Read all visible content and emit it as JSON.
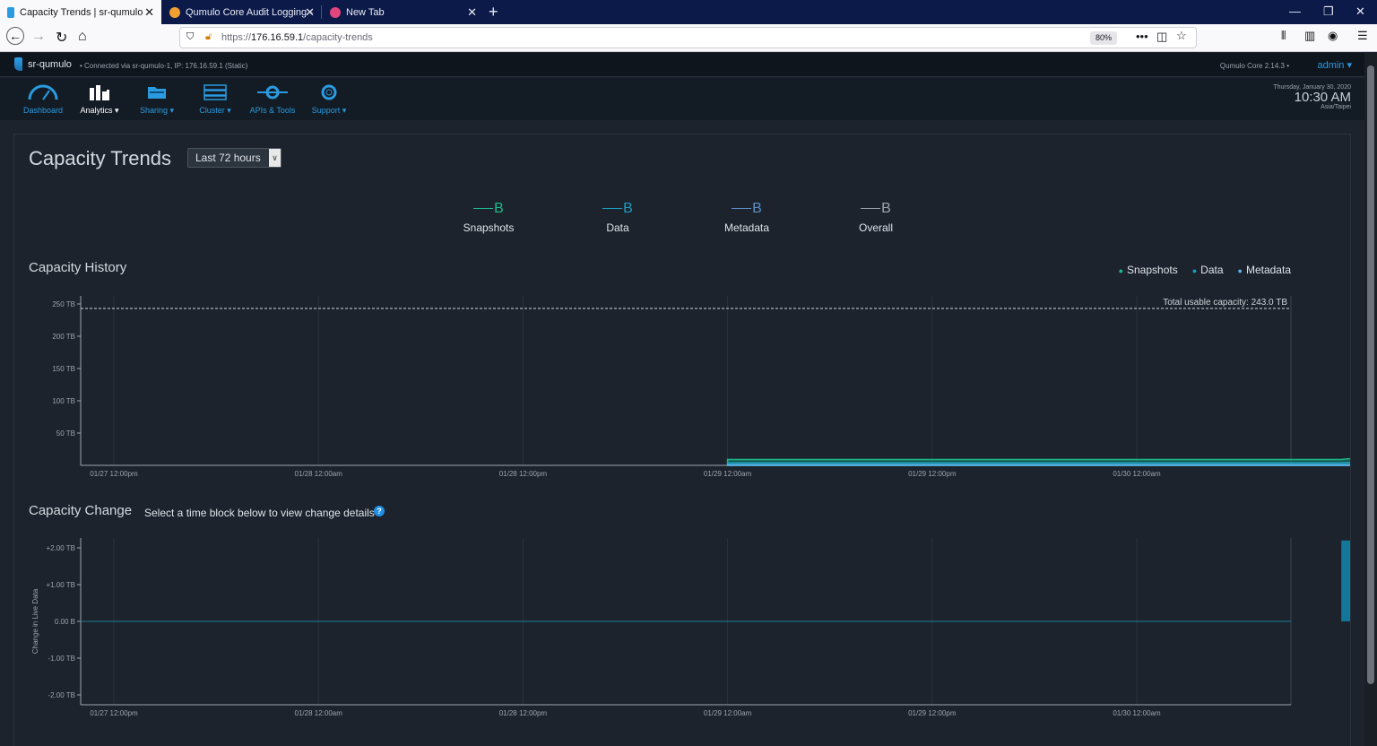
{
  "browser": {
    "tabs": [
      {
        "title": "Capacity Trends | sr-qumulo",
        "active": true
      },
      {
        "title": "Qumulo Core Audit Logging -",
        "active": false
      },
      {
        "title": "New Tab",
        "active": false
      }
    ],
    "url_prefix": "https://",
    "url_host": "176.16.59.1",
    "url_path": "/capacity-trends",
    "zoom": "80%"
  },
  "qumulo": {
    "cluster_name": "sr-qumulo",
    "connection": "Connected via sr-qumulo-1, IP: 176.16.59.1 (Static)",
    "version": "Qumulo Core 2.14.3",
    "user": "admin",
    "menu": [
      {
        "label": "Dashboard",
        "icon": "gauge-icon",
        "active": false
      },
      {
        "label": "Analytics ▾",
        "icon": "bar-chart-icon",
        "active": true
      },
      {
        "label": "Sharing ▾",
        "icon": "folder-share-icon",
        "active": false
      },
      {
        "label": "Cluster ▾",
        "icon": "server-icon",
        "active": false
      },
      {
        "label": "APIs & Tools",
        "icon": "api-icon",
        "active": false
      },
      {
        "label": "Support ▾",
        "icon": "lifebuoy-icon",
        "active": false
      }
    ],
    "clock": {
      "date": "Thursday, January 30, 2020",
      "time": "10:30 AM",
      "zone": "Asia/Taipei"
    }
  },
  "page": {
    "title": "Capacity Trends",
    "range_select": "Last 72 hours",
    "stats": [
      {
        "value": "B",
        "label": "Snapshots",
        "color": "#1abc8c"
      },
      {
        "value": "B",
        "label": "Data",
        "color": "#1a9fc0"
      },
      {
        "value": "B",
        "label": "Metadata",
        "color": "#5b8fc6"
      },
      {
        "value": "B",
        "label": "Overall",
        "color": "#9aa3ad"
      }
    ],
    "history_title": "Capacity History",
    "change_title": "Capacity Change",
    "change_hint": "Select a time block below to view change details",
    "legend": [
      {
        "label": "Snapshots",
        "color": "#1abc8c"
      },
      {
        "label": "Data",
        "color": "#1a9fc0"
      },
      {
        "label": "Metadata",
        "color": "#5bb0e6"
      }
    ]
  },
  "chart_data": [
    {
      "type": "area",
      "title": "Capacity History",
      "x": [
        "01/27 12:00pm",
        "01/28 12:00am",
        "01/28 12:00pm",
        "01/29 12:00am",
        "01/29 12:00pm",
        "01/30 12:00am"
      ],
      "ytick_labels": [
        "50 TB",
        "100 TB",
        "150 TB",
        "200 TB",
        "250 TB"
      ],
      "ylim": [
        0,
        250
      ],
      "annotation": "Total usable capacity: 243.0 TB",
      "capacity_line": 243.0,
      "series": [
        {
          "name": "Snapshots",
          "points": [
            [
              3.0,
              9
            ],
            [
              6.0,
              9
            ],
            [
              6.15,
              14
            ],
            [
              6.5,
              14
            ]
          ]
        },
        {
          "name": "Data",
          "points": [
            [
              3.0,
              4
            ],
            [
              6.0,
              4
            ],
            [
              6.15,
              6
            ],
            [
              6.5,
              6
            ]
          ]
        },
        {
          "name": "Metadata",
          "points": [
            [
              3.0,
              1
            ],
            [
              6.5,
              1
            ]
          ]
        }
      ]
    },
    {
      "type": "bar",
      "title": "Capacity Change",
      "ylabel": "Change in Live Data",
      "x": [
        "01/27 12:00pm",
        "01/28 12:00am",
        "01/28 12:00pm",
        "01/29 12:00am",
        "01/29 12:00pm",
        "01/30 12:00am"
      ],
      "ytick_labels": [
        "-2.00 TB",
        "-1.00 TB",
        "0.00 B",
        "+1.00 TB",
        "+2.00 TB"
      ],
      "ylim": [
        -2.3,
        2.3
      ],
      "bars": [
        {
          "start": 6.0,
          "end": 6.08,
          "value": 2.2
        },
        {
          "start": 6.09,
          "end": 6.17,
          "value": 2.15
        }
      ]
    }
  ]
}
